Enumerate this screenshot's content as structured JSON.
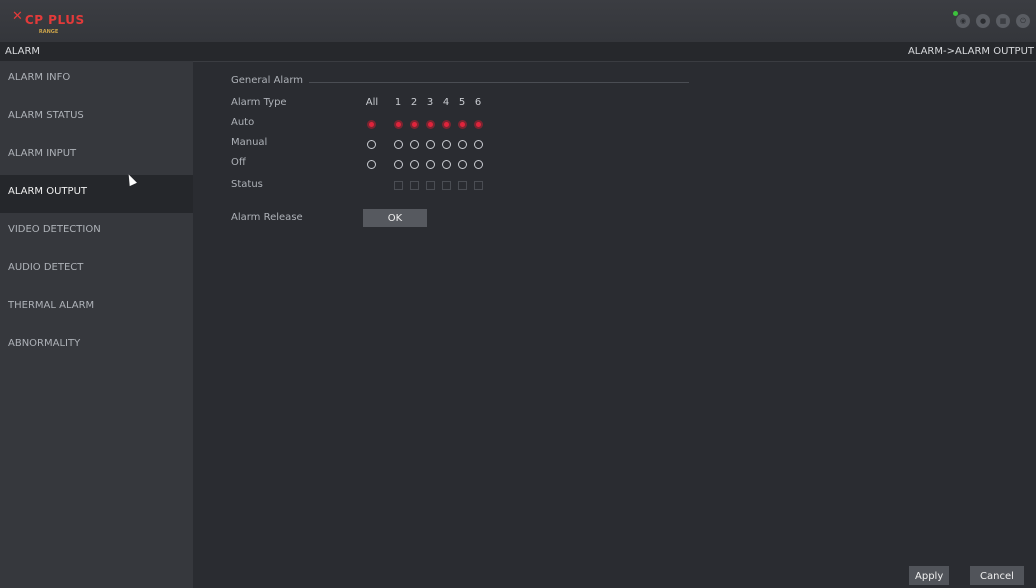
{
  "header": {
    "logo_text": "CP PLUS",
    "logo_sub": "RANGE",
    "icons": [
      "eye-icon",
      "user-icon",
      "grid-icon",
      "power-icon"
    ]
  },
  "titlebar": {
    "title": "ALARM",
    "breadcrumb": "ALARM->ALARM OUTPUT"
  },
  "sidebar": {
    "items": [
      {
        "label": "ALARM INFO"
      },
      {
        "label": "ALARM STATUS"
      },
      {
        "label": "ALARM INPUT"
      },
      {
        "label": "ALARM OUTPUT"
      },
      {
        "label": "VIDEO DETECTION"
      },
      {
        "label": "AUDIO DETECT"
      },
      {
        "label": "THERMAL ALARM"
      },
      {
        "label": "ABNORMALITY"
      }
    ],
    "active": "ALARM OUTPUT"
  },
  "general_alarm": {
    "title": "General Alarm",
    "columns": [
      "All",
      "1",
      "2",
      "3",
      "4",
      "5",
      "6"
    ],
    "rows": {
      "alarm_type": "Alarm Type",
      "auto": "Auto",
      "manual": "Manual",
      "off": "Off",
      "status": "Status"
    },
    "selected_mode": "Auto",
    "alarm_release_label": "Alarm Release",
    "alarm_release_button": "OK"
  },
  "footer": {
    "apply": "Apply",
    "cancel": "Cancel"
  },
  "colors": {
    "accent": "#e0243c",
    "background": "#2a2c31",
    "sidebar": "#36383d"
  }
}
